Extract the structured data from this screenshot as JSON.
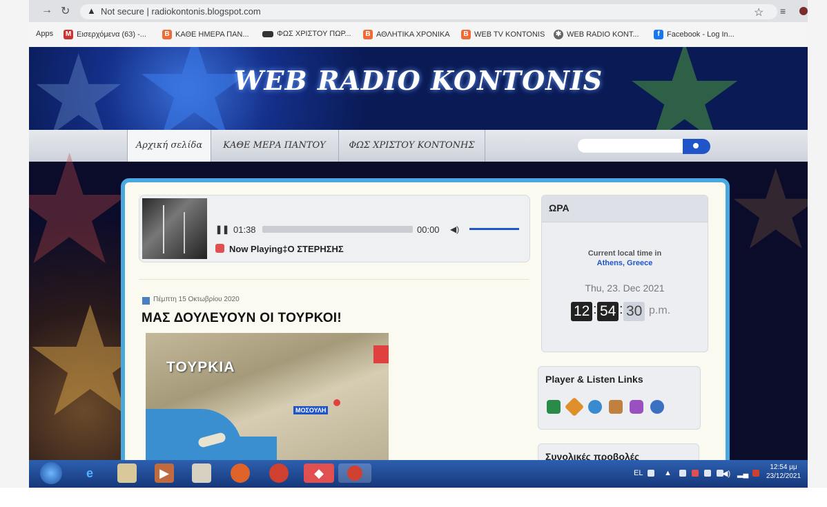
{
  "browser": {
    "security_label": "Not secure",
    "url": "radiokontonis.blogspot.com",
    "bookmarks": [
      {
        "label": "Apps",
        "icon": "apps-grid-icon"
      },
      {
        "label": "Εισερχόμενα (63) -...",
        "icon": "gmail-icon"
      },
      {
        "label": "ΚΑΘΕ ΗΜΕΡΑ ΠΑΝ...",
        "icon": "blogger-icon"
      },
      {
        "label": "ΦΩΣ ΧΡΙΣΤΟΥ ΠΩΡ...",
        "icon": "site-icon"
      },
      {
        "label": "ΑΘΛΗΤΙΚΑ ΧΡΟΝΙΚΑ",
        "icon": "blogger-icon"
      },
      {
        "label": "WEB TV KONTONIS",
        "icon": "blogger-icon"
      },
      {
        "label": "WEB RADIO KONT...",
        "icon": "radio-icon"
      },
      {
        "label": "Facebook - Log In...",
        "icon": "facebook-icon"
      }
    ]
  },
  "site": {
    "title": "WEB RADIO KONTONIS",
    "menu": [
      "Αρχική σελίδα",
      "ΚΑΘΕ ΜΕΡΑ ΠΑΝΤΟΥ",
      "ΦΩΣ ΧΡΙΣΤΟΥ ΚΟΝΤΟΝΗΣ"
    ]
  },
  "player": {
    "elapsed": "01:38",
    "remaining": "00:00",
    "now_playing": "Now Playing‡Ο ΣΤΕΡΗΣΗΣ"
  },
  "post": {
    "date": "Πέμπτη 15 Οκτωβρίου 2020",
    "title": "ΜΑΣ ΔΟΥΛΕΥΟΥΝ ΟΙ ΤΟΥΡΚΟΙ!",
    "map_country": "ΤΟΥΡΚΙΑ",
    "map_city": "ΜΟΣΟΥΛΗ"
  },
  "sidebar": {
    "clock": {
      "title": "ΩΡΑ",
      "label": "Current local time in",
      "city": "Athens, Greece",
      "date": "Thu, 23. Dec 2021",
      "hours": "12",
      "minutes": "54",
      "seconds": "30",
      "ampm": "p.m."
    },
    "links_title": "Player & Listen Links",
    "views_title": "Συνολικές προβολές"
  },
  "taskbar": {
    "language": "EL",
    "clock_time": "12:54 μμ",
    "clock_date": "23/12/2021"
  },
  "colors": {
    "accent": "#1f55c9",
    "frame": "#4aa8e0",
    "taskbar": "#16387a"
  }
}
